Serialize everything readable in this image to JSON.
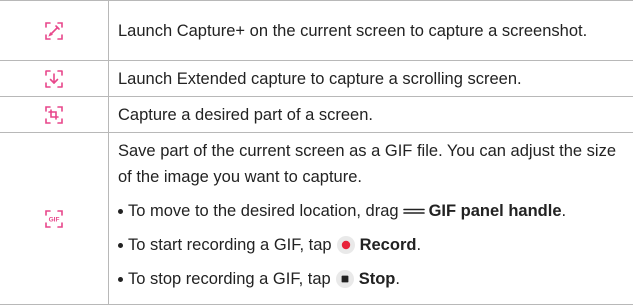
{
  "colors": {
    "accent": "#e8478b",
    "record_red": "#e8233a",
    "grid": "#b8b8b8",
    "text": "#222222"
  },
  "rows": [
    {
      "icon": "pencil-capture-icon",
      "text": "Launch Capture+ on the current screen to capture a screenshot."
    },
    {
      "icon": "extended-capture-icon",
      "text": "Launch Extended capture to capture a scrolling screen."
    },
    {
      "icon": "crop-capture-icon",
      "text": "Capture a desired part of a screen."
    },
    {
      "icon": "gif-capture-icon",
      "intro": "Save part of the current screen as a GIF file. You can adjust the size of the image you want to capture.",
      "bullets": [
        {
          "prefix": "To move to the desired location, drag",
          "icon": "drag-handle-icon",
          "bold": "GIF panel handle",
          "suffix": "."
        },
        {
          "prefix": "To start recording a GIF, tap",
          "icon": "record-icon",
          "bold": "Record",
          "suffix": "."
        },
        {
          "prefix": "To stop recording a GIF, tap",
          "icon": "stop-icon",
          "bold": "Stop",
          "suffix": "."
        }
      ]
    }
  ]
}
